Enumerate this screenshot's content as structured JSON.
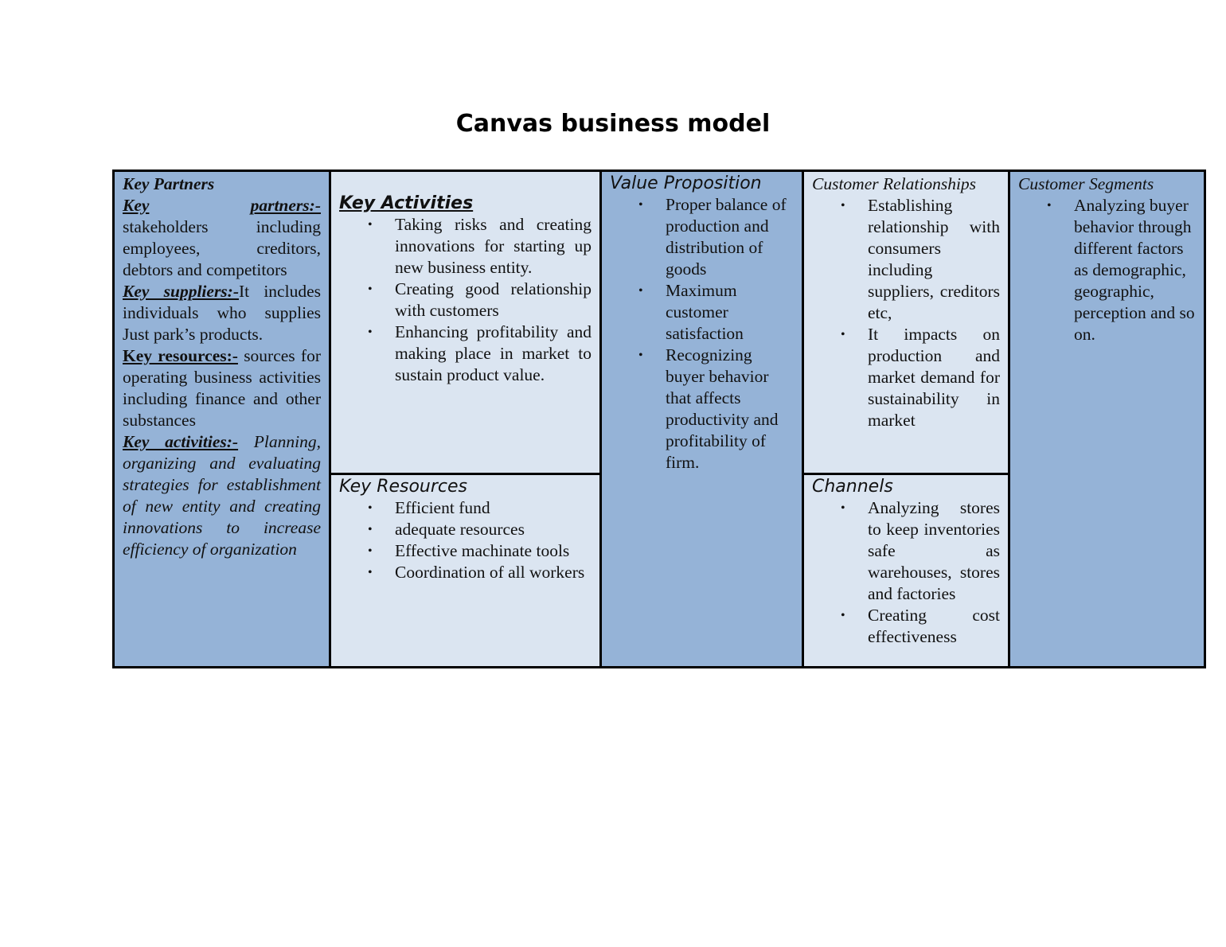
{
  "title": "Canvas business model",
  "colors": {
    "dark_cell": "#95b3d7",
    "light_cell": "#dbe5f1",
    "border": "#000000"
  },
  "key_partners": {
    "heading": "Key Partners",
    "sections": [
      {
        "label_a": "Key",
        "label_b": "partners:-",
        "text": "stakeholders including employees, creditors, debtors and competitors"
      },
      {
        "label": "Key suppliers:-",
        "text": "It includes individuals who supplies Just park’s products."
      },
      {
        "label": "Key resources:-",
        "text": " sources for operating business activities including finance and other substances"
      },
      {
        "label": "Key activities:-",
        "text": " Planning, organizing and evaluating strategies for establishment of new entity and creating innovations to increase efficiency of organization"
      }
    ]
  },
  "key_activities": {
    "heading": "Key Activities",
    "items": [
      "Taking risks and creating innovations for starting up new business entity.",
      "Creating good relationship with customers",
      "Enhancing profitability and making place in market to sustain product value."
    ]
  },
  "key_resources": {
    "heading": "Key Resources",
    "items": [
      "Efficient fund",
      "adequate resources",
      "Effective machinate tools",
      "Coordination of all workers"
    ]
  },
  "value_proposition": {
    "heading": "Value Proposition",
    "items": [
      "Proper balance of production and distribution of goods",
      "Maximum customer satisfaction",
      "Recognizing buyer behavior that affects productivity and profitability of firm."
    ]
  },
  "customer_relationships": {
    "heading": "Customer Relationships",
    "items": [
      "Establishing relationship with consumers including suppliers, creditors etc,",
      "It impacts on production and market demand for sustainability in market"
    ]
  },
  "channels": {
    "heading": "Channels",
    "items": [
      "Analyzing stores to keep inventories safe as warehouses, stores and factories",
      "Creating cost effectiveness"
    ]
  },
  "customer_segments": {
    "heading": "Customer Segments",
    "items": [
      "Analyzing buyer behavior through different factors as demographic, geographic, perception and so on."
    ]
  },
  "bullet_glyph": "•"
}
